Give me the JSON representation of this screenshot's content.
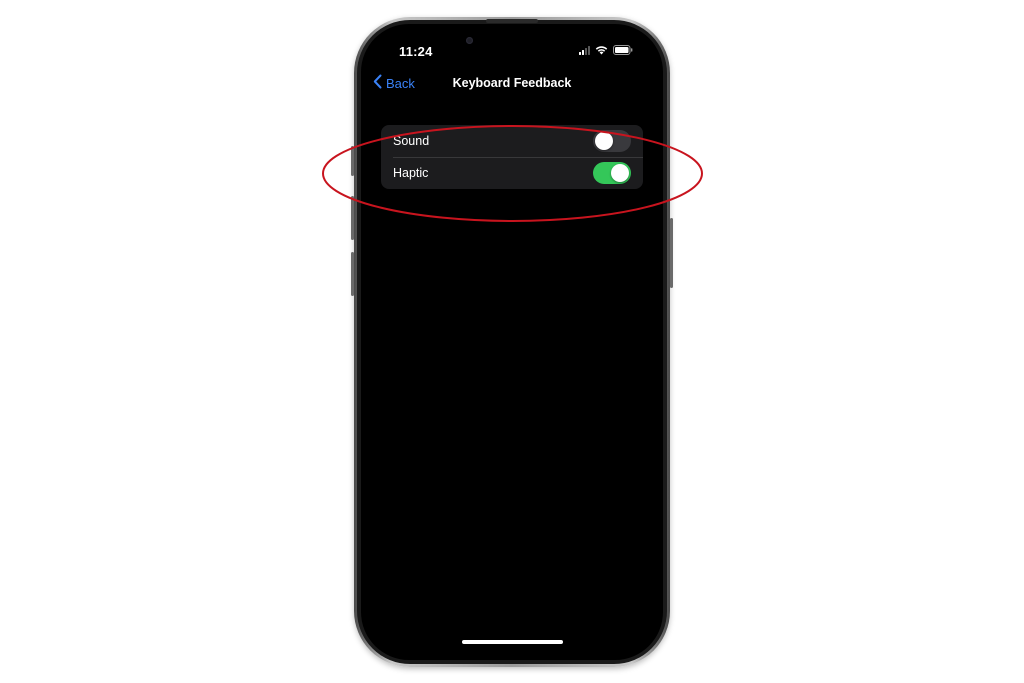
{
  "status_bar": {
    "time": "11:24",
    "icons": [
      "cellular-signal-icon",
      "wifi-icon",
      "battery-icon"
    ]
  },
  "nav": {
    "back_label": "Back",
    "back_icon": "chevron-left-icon",
    "title": "Keyboard Feedback"
  },
  "settings": {
    "rows": [
      {
        "label": "Sound",
        "on": false
      },
      {
        "label": "Haptic",
        "on": true
      }
    ]
  },
  "colors": {
    "accent_blue": "#3a82f7",
    "toggle_on": "#34c759",
    "toggle_off": "#39393d",
    "annotation_red": "#c8141e",
    "screen_bg": "#000000",
    "group_bg": "#1c1c1e"
  },
  "annotation": {
    "shape": "ellipse",
    "color": "#c8141e",
    "target": "settings-group"
  }
}
